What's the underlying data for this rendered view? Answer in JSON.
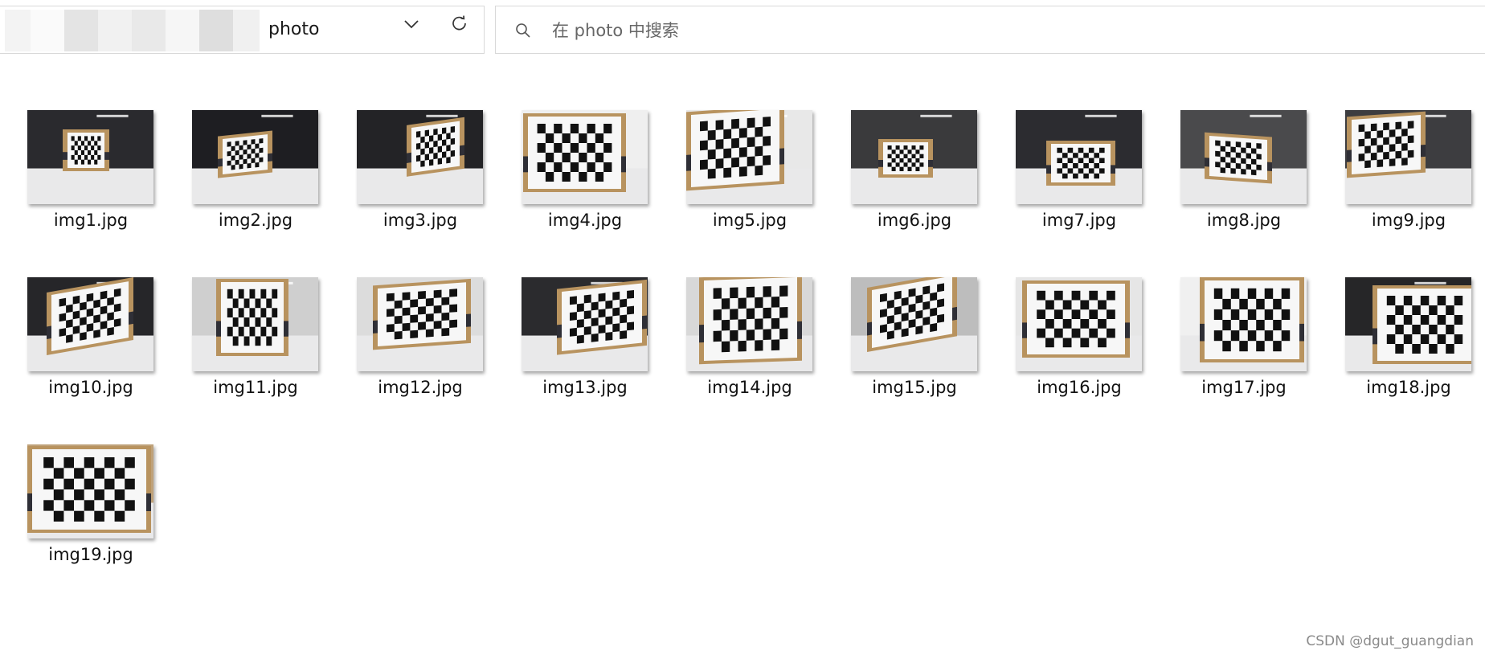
{
  "address_bar": {
    "folder": "photo",
    "dropdown_icon": "chevron-down-icon",
    "refresh_icon": "refresh-icon"
  },
  "search": {
    "placeholder": "在 photo 中搜索",
    "icon": "search-icon"
  },
  "files": [
    {
      "name": "img1.jpg"
    },
    {
      "name": "img2.jpg"
    },
    {
      "name": "img3.jpg"
    },
    {
      "name": "img4.jpg"
    },
    {
      "name": "img5.jpg"
    },
    {
      "name": "img6.jpg"
    },
    {
      "name": "img7.jpg"
    },
    {
      "name": "img8.jpg"
    },
    {
      "name": "img9.jpg"
    },
    {
      "name": "img10.jpg"
    },
    {
      "name": "img11.jpg"
    },
    {
      "name": "img12.jpg"
    },
    {
      "name": "img13.jpg"
    },
    {
      "name": "img14.jpg"
    },
    {
      "name": "img15.jpg"
    },
    {
      "name": "img16.jpg"
    },
    {
      "name": "img17.jpg"
    },
    {
      "name": "img18.jpg"
    },
    {
      "name": "img19.jpg"
    }
  ],
  "watermark": "CSDN @dgut_guangdian"
}
